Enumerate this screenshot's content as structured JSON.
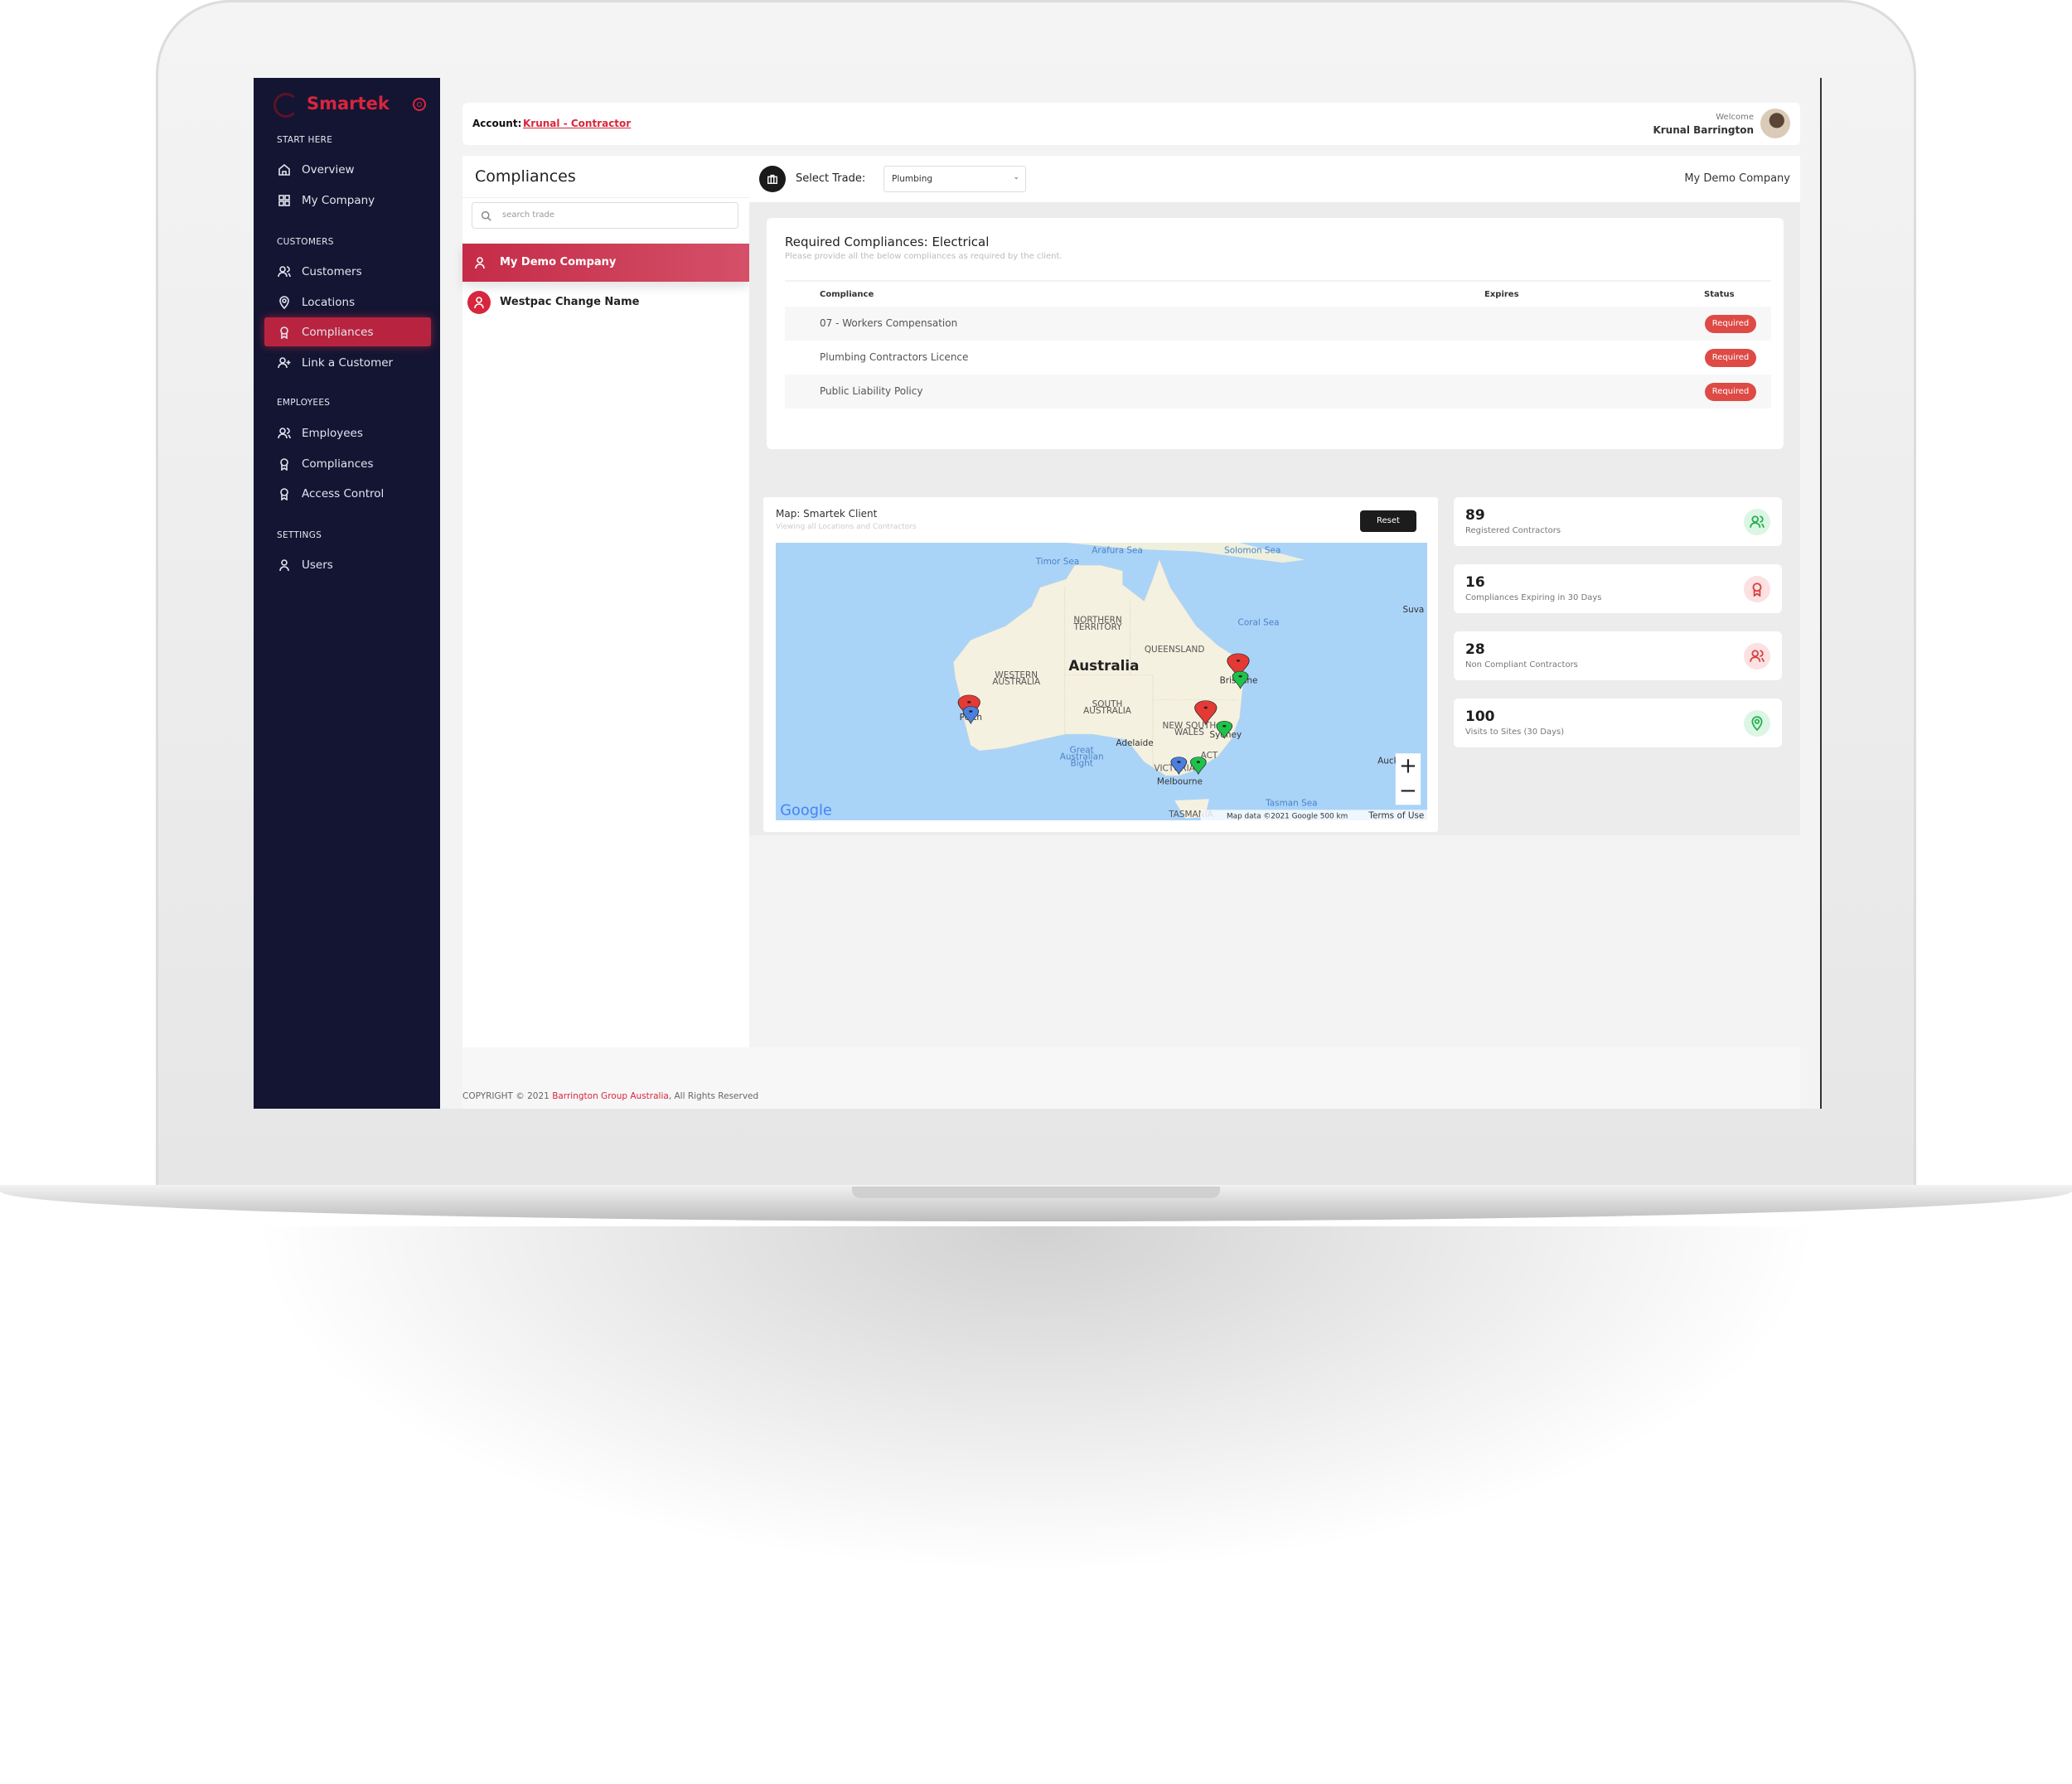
{
  "brand": {
    "name": "Smartek",
    "accent": "#d7263d",
    "sidebar_bg": "#141533"
  },
  "sidebar": {
    "sections": [
      {
        "title": "START HERE",
        "items": [
          {
            "label": "Overview",
            "icon": "home-icon"
          },
          {
            "label": "My Company",
            "icon": "grid-icon"
          }
        ]
      },
      {
        "title": "CUSTOMERS",
        "items": [
          {
            "label": "Customers",
            "icon": "users-icon"
          },
          {
            "label": "Locations",
            "icon": "map-pin-icon"
          },
          {
            "label": "Compliances",
            "icon": "award-icon",
            "active": true
          },
          {
            "label": "Link a Customer",
            "icon": "user-plus-icon"
          }
        ]
      },
      {
        "title": "EMPLOYEES",
        "items": [
          {
            "label": "Employees",
            "icon": "users-icon"
          },
          {
            "label": "Compliances",
            "icon": "award-icon"
          },
          {
            "label": "Access Control",
            "icon": "award-icon"
          }
        ]
      },
      {
        "title": "SETTINGS",
        "items": [
          {
            "label": "Users",
            "icon": "user-icon"
          }
        ]
      }
    ]
  },
  "header": {
    "account_label": "Account:",
    "account_value": "Krunal - Contractor",
    "welcome": "Welcome",
    "user_name": "Krunal Barrington"
  },
  "compliances_panel": {
    "title": "Compliances",
    "search_placeholder": "search trade",
    "items": [
      {
        "label": "My Demo Company",
        "selected": true
      },
      {
        "label": "Westpac Change Name",
        "selected": false
      }
    ]
  },
  "toolbar": {
    "select_label": "Select Trade:",
    "trade_value": "Plumbing",
    "company": "My Demo Company"
  },
  "required": {
    "title": "Required Compliances: Electrical",
    "subtitle": "Please provide all the below compliances as required by the client.",
    "columns": [
      "Compliance",
      "Expires",
      "Status"
    ],
    "rows": [
      {
        "name": "07 - Workers Compensation",
        "expires": "",
        "status": "Required"
      },
      {
        "name": "Plumbing Contractors Licence",
        "expires": "",
        "status": "Required"
      },
      {
        "name": "Public Liability Policy",
        "expires": "",
        "status": "Required"
      }
    ]
  },
  "map": {
    "title": "Map: Smartek Client",
    "subtitle": "Viewing all Locations and Contractors",
    "reset": "Reset",
    "labels": {
      "country": "Australia",
      "nt": "NORTHERN",
      "nt2": "TERRITORY",
      "wa": "WESTERN",
      "wa2": "AUSTRALIA",
      "qld": "QUEENSLAND",
      "sa": "SOUTH",
      "sa2": "AUSTRALIA",
      "nsw": "NEW SOUTH",
      "nsw2": "WALES",
      "vic": "VICTORIA",
      "act": "ACT",
      "tas": "TASMANIA",
      "timor": "Timor Sea",
      "arafura": "Arafura Sea",
      "solomon": "Solomon Sea",
      "coral": "Coral Sea",
      "tasman": "Tasman Sea",
      "bight1": "Great",
      "bight2": "Australian",
      "bight3": "Bight",
      "perth": "Perth",
      "adelaide": "Adelaide",
      "melbourne": "Melbourne",
      "sydney": "Sydney",
      "brisbane": "Brisbane",
      "auck": "Auck",
      "suva": "Suva"
    },
    "attribution": "Map data ©2021 Google   500 km",
    "terms": "Terms of Use",
    "logo": "Google",
    "zoom_in": "+",
    "zoom_out": "−",
    "pin_colors": {
      "red": "#e53935",
      "green": "#1fc24a",
      "blue": "#4a7fe0"
    }
  },
  "stats": [
    {
      "value": "89",
      "label": "Registered Contractors",
      "icon": "users-icon",
      "tone": "green"
    },
    {
      "value": "16",
      "label": "Compliances Expiring in 30 Days",
      "icon": "award-icon",
      "tone": "red"
    },
    {
      "value": "28",
      "label": "Non Compliant Contractors",
      "icon": "users-icon",
      "tone": "red"
    },
    {
      "value": "100",
      "label": "Visits to Sites (30 Days)",
      "icon": "map-pin-icon",
      "tone": "green"
    }
  ],
  "footer": {
    "prefix": "COPYRIGHT © 2021",
    "link": "Barrington Group Australia",
    "suffix": ", All Rights Reserved"
  }
}
